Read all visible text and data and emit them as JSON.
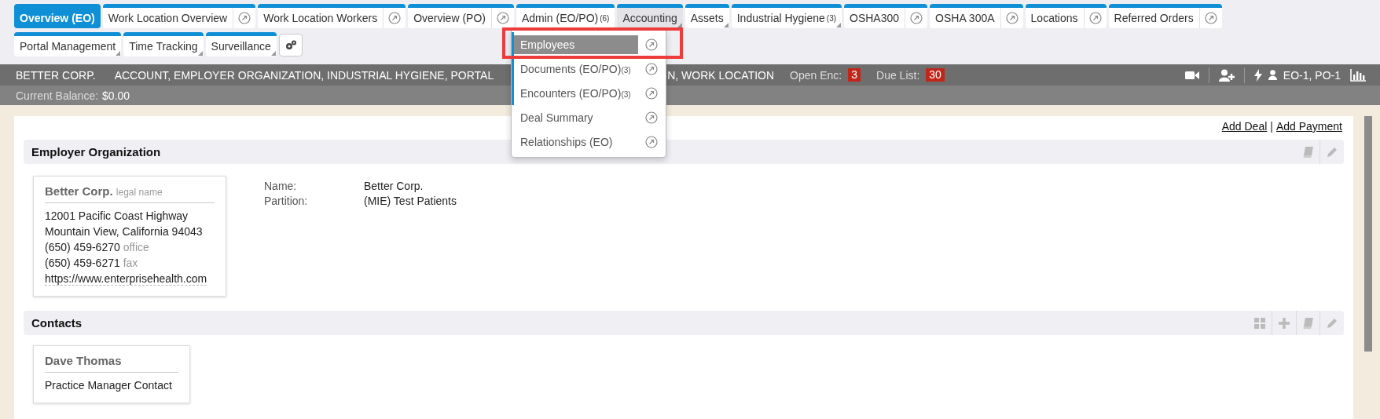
{
  "tabs_row_1": [
    {
      "label": "Overview (EO)",
      "kind": "plain",
      "selected": true,
      "highlighted": false
    },
    {
      "label": "Work Location Overview",
      "kind": "popout",
      "selected": false,
      "highlighted": false
    },
    {
      "label": "Work Location Workers",
      "kind": "popout",
      "selected": false,
      "highlighted": false
    },
    {
      "label": "Overview (PO)",
      "kind": "popout",
      "selected": false,
      "highlighted": false
    },
    {
      "label": "Admin (EO/PO)",
      "count": "(6)",
      "kind": "plain",
      "selected": false,
      "highlighted": false
    },
    {
      "label": "Accounting",
      "kind": "menu",
      "selected": false,
      "highlighted": true
    },
    {
      "label": "Assets",
      "kind": "menu",
      "selected": false,
      "highlighted": false
    },
    {
      "label": "Industrial Hygiene",
      "count": "(3)",
      "kind": "menu",
      "selected": false,
      "highlighted": false
    },
    {
      "label": "OSHA300",
      "kind": "popout",
      "selected": false,
      "highlighted": false
    },
    {
      "label": "OSHA 300A",
      "kind": "popout",
      "selected": false,
      "highlighted": false
    },
    {
      "label": "Locations",
      "kind": "popout",
      "selected": false,
      "highlighted": false
    },
    {
      "label": "Referred Orders",
      "kind": "popout",
      "selected": false,
      "highlighted": false
    }
  ],
  "tabs_row_2": [
    {
      "label": "Portal Management",
      "kind": "menu",
      "selected": false,
      "highlighted": false
    },
    {
      "label": "Time Tracking",
      "kind": "menu",
      "selected": false,
      "highlighted": false
    },
    {
      "label": "Surveillance",
      "kind": "menu",
      "selected": false,
      "highlighted": false
    }
  ],
  "dropdown": {
    "items": [
      {
        "label": "Employees",
        "selected": true,
        "marked": true,
        "annotated": true
      },
      {
        "label": "Documents (EO/PO)",
        "count": "(3)",
        "selected": false,
        "marked": true,
        "annotated": false
      },
      {
        "label": "Encounters (EO/PO)",
        "count": "(3)",
        "selected": false,
        "marked": true,
        "annotated": false
      },
      {
        "label": "Deal Summary",
        "selected": false,
        "marked": false,
        "annotated": false
      },
      {
        "label": "Relationships (EO)",
        "selected": false,
        "marked": false,
        "annotated": false
      }
    ]
  },
  "header": {
    "company": "BETTER CORP.",
    "roles_before": "ACCOUNT, EMPLOYER ORGANIZATION, INDUSTRIAL HYGIENE, PORTAL",
    "roles_after": "N, WORK LOCATION",
    "open_enc_label": "Open Enc:",
    "open_enc_count": "3",
    "due_list_label": "Due List:",
    "due_list_count": "30",
    "user_orgs": "EO-1, PO-1",
    "balance_label": "Current Balance:",
    "balance_value": "$0.00"
  },
  "links": [
    "Add Deal",
    "Add Payment"
  ],
  "link_separator": "|",
  "employer_organization": {
    "title": "Employer Organization",
    "card": {
      "name": "Better Corp.",
      "name_note": "legal name",
      "lines": [
        {
          "text": "12001 Pacific Coast Highway"
        },
        {
          "text": "Mountain View, California 94043"
        },
        {
          "text": "(650) 459-6270",
          "note": "office"
        },
        {
          "text": "(650) 459-6271",
          "note": "fax"
        },
        {
          "text": "https://www.enterprisehealth.com",
          "kind": "link"
        }
      ]
    },
    "fields": [
      {
        "label": "Name:",
        "value": "Better Corp."
      },
      {
        "label": "Partition:",
        "value": "(MIE) Test Patients"
      }
    ]
  },
  "contacts": {
    "title": "Contacts",
    "card": {
      "name": "Dave Thomas",
      "lines": [
        {
          "text": "Practice Manager Contact"
        }
      ]
    }
  }
}
